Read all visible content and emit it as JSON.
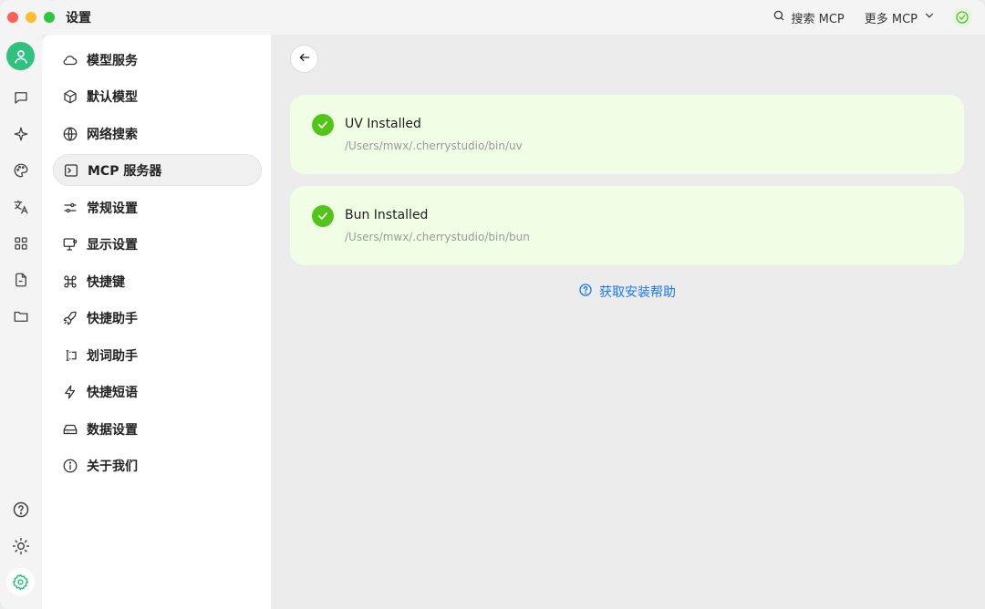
{
  "window": {
    "title": "设置"
  },
  "toolbar": {
    "search_mcp": "搜索 MCP",
    "more_mcp": "更多 MCP"
  },
  "colors": {
    "accent_green": "#52c41a",
    "link_blue": "#1677ff",
    "card_bg": "#f1fee6",
    "avatar_green": "#2ec27e"
  },
  "rail": {
    "items": [
      "avatar",
      "chat-icon",
      "sparkle-icon",
      "palette-icon",
      "translate-icon",
      "apps-icon",
      "document-icon",
      "folder-icon",
      "help-icon",
      "theme-icon",
      "settings-icon"
    ]
  },
  "nav": {
    "items": [
      {
        "label": "模型服务",
        "icon": "cloud-icon"
      },
      {
        "label": "默认模型",
        "icon": "cube-icon"
      },
      {
        "label": "网络搜索",
        "icon": "globe-icon"
      },
      {
        "label": "MCP 服务器",
        "icon": "terminal-icon",
        "active": true
      },
      {
        "label": "常规设置",
        "icon": "sliders-icon"
      },
      {
        "label": "显示设置",
        "icon": "monitor-icon"
      },
      {
        "label": "快捷键",
        "icon": "command-icon"
      },
      {
        "label": "快捷助手",
        "icon": "rocket-icon"
      },
      {
        "label": "划词助手",
        "icon": "text-select-icon"
      },
      {
        "label": "快捷短语",
        "icon": "zap-icon"
      },
      {
        "label": "数据设置",
        "icon": "drive-icon"
      },
      {
        "label": "关于我们",
        "icon": "info-icon"
      }
    ]
  },
  "main": {
    "cards": [
      {
        "title": "UV Installed",
        "path": "/Users/mwx/.cherrystudio/bin/uv"
      },
      {
        "title": "Bun Installed",
        "path": "/Users/mwx/.cherrystudio/bin/bun"
      }
    ],
    "help_link": "获取安装帮助"
  }
}
